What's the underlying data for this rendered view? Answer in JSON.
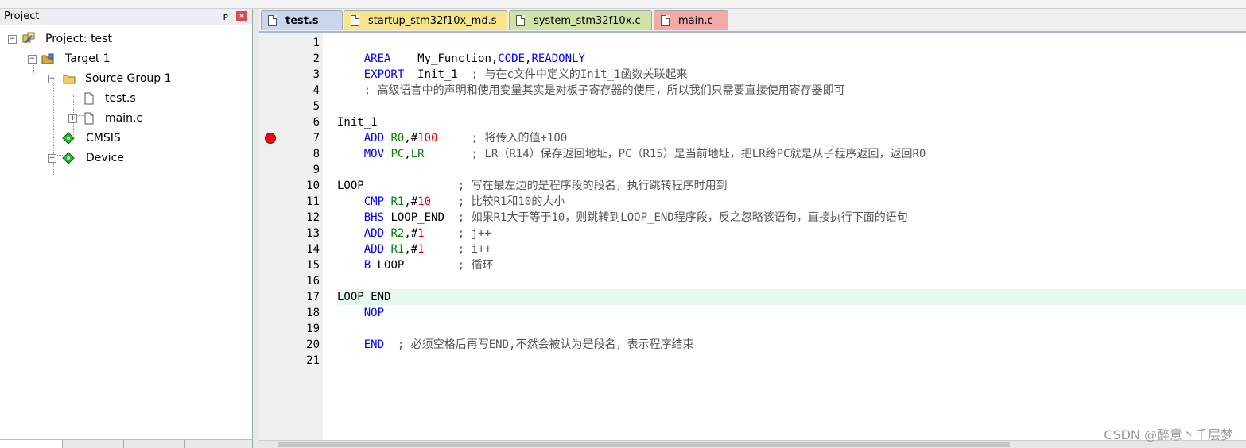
{
  "project_panel": {
    "title": "Project",
    "pin_glyph": "ᴘ",
    "close_glyph": "×",
    "tree": [
      {
        "label": "Project: test",
        "icon": "project-icon"
      },
      {
        "label": "Target 1",
        "icon": "target-icon"
      },
      {
        "label": "Source Group 1",
        "icon": "folder-icon"
      },
      {
        "label": "test.s",
        "icon": "file-icon"
      },
      {
        "label": "main.c",
        "icon": "file-icon"
      },
      {
        "label": "CMSIS",
        "icon": "component-icon"
      },
      {
        "label": "Device",
        "icon": "component-icon"
      }
    ]
  },
  "editor": {
    "tabs": [
      {
        "label": "test.s",
        "color": "#c9d7ee",
        "active": true
      },
      {
        "label": "startup_stm32f10x_md.s",
        "color": "#f6e58d"
      },
      {
        "label": "system_stm32f10x.c",
        "color": "#cfe3a6"
      },
      {
        "label": "main.c",
        "color": "#f4a9a9"
      }
    ],
    "lines": [
      {
        "n": "1",
        "text": ""
      },
      {
        "n": "2",
        "text": "    AREA    My_Function,CODE,READONLY"
      },
      {
        "n": "3",
        "text": "    EXPORT  Init_1  ; 与在c文件中定义的Init_1函数关联起来"
      },
      {
        "n": "4",
        "text": "    ; 高级语言中的声明和使用变量其实是对板子寄存器的使用，所以我们只需要直接使用寄存器即可"
      },
      {
        "n": "5",
        "text": ""
      },
      {
        "n": "6",
        "text": "Init_1"
      },
      {
        "n": "7",
        "text": "    ADD R0,#100     ; 将传入的值+100"
      },
      {
        "n": "8",
        "text": "    MOV PC,LR       ; LR（R14）保存返回地址，PC（R15）是当前地址，把LR给PC就是从子程序返回，返回R0"
      },
      {
        "n": "9",
        "text": ""
      },
      {
        "n": "10",
        "text": "LOOP              ; 写在最左边的是程序段的段名，执行跳转程序时用到"
      },
      {
        "n": "11",
        "text": "    CMP R1,#10    ; 比较R1和10的大小"
      },
      {
        "n": "12",
        "text": "    BHS LOOP_END  ; 如果R1大于等于10，则跳转到LOOP_END程序段，反之忽略该语句，直接执行下面的语句"
      },
      {
        "n": "13",
        "text": "    ADD R2,#1     ; j++"
      },
      {
        "n": "14",
        "text": "    ADD R1,#1     ; i++"
      },
      {
        "n": "15",
        "text": "    B LOOP        ; 循环"
      },
      {
        "n": "16",
        "text": ""
      },
      {
        "n": "17",
        "text": "LOOP_END"
      },
      {
        "n": "18",
        "text": "    NOP"
      },
      {
        "n": "19",
        "text": ""
      },
      {
        "n": "20",
        "text": "    END  ; 必须空格后再写END,不然会被认为是段名，表示程序结束"
      },
      {
        "n": "21",
        "text": ""
      }
    ],
    "breakpoint_line": "7",
    "highlight_line": "17"
  },
  "watermark": "CSDN @醉意丶千层梦"
}
